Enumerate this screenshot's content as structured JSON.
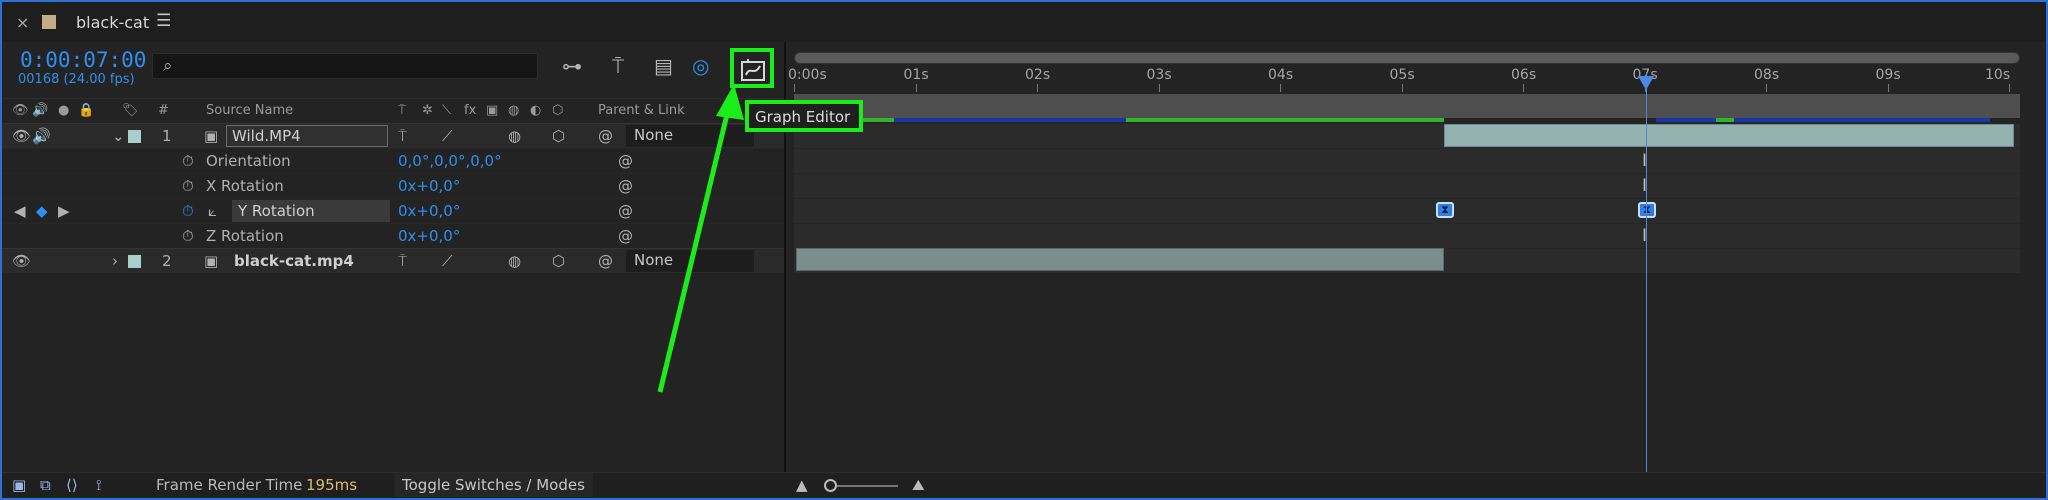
{
  "tab": {
    "title": "black-cat",
    "close_icon": "close-icon",
    "menu_icon": "hamburger-icon"
  },
  "comp": {
    "timecode": "0:00:07:00",
    "frame_info": "00168 (24.00 fps)",
    "search_placeholder": ""
  },
  "tooltip": {
    "text": "Graph Editor"
  },
  "columns": {
    "number": "#",
    "source_name": "Source Name",
    "parent_link": "Parent & Link"
  },
  "layers": [
    {
      "number": "1",
      "name": "Wild.MP4",
      "parent": "None"
    },
    {
      "number": "2",
      "name": "black-cat.mp4",
      "parent": "None"
    }
  ],
  "properties": [
    {
      "name": "Orientation",
      "value": "0,0°,0,0°,0,0°"
    },
    {
      "name": "X Rotation",
      "value": "0x+0,0°"
    },
    {
      "name": "Y Rotation",
      "value": "0x+0,0°"
    },
    {
      "name": "Z Rotation",
      "value": "0x+0,0°"
    }
  ],
  "ruler": {
    "labels": [
      "0:00s",
      "01s",
      "02s",
      "03s",
      "04s",
      "05s",
      "06s",
      "07s",
      "08s",
      "09s",
      "10s"
    ]
  },
  "bottom": {
    "frame_render_label": "Frame Render Time",
    "frame_render_value": "195ms",
    "toggle_label": "Toggle Switches / Modes"
  },
  "colors": {
    "accent_blue": "#2f8ef0",
    "highlight_green": "#1bed1b",
    "label_teal": "#a8cfcc"
  }
}
